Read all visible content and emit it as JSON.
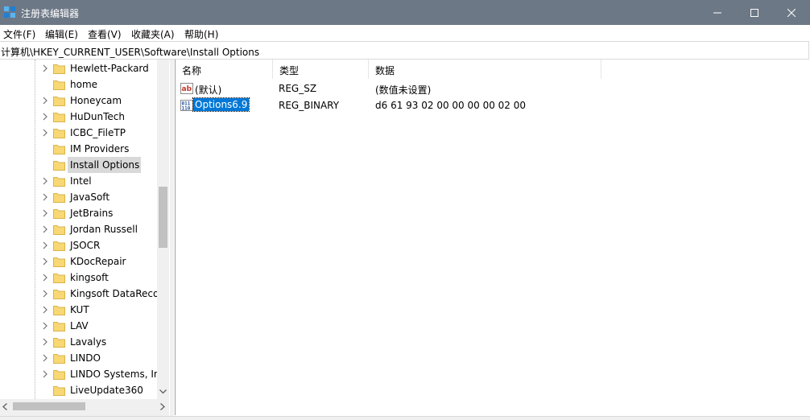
{
  "window": {
    "title": "注册表编辑器"
  },
  "menu": [
    "文件(F)",
    "编辑(E)",
    "查看(V)",
    "收藏夹(A)",
    "帮助(H)"
  ],
  "address": "计算机\\HKEY_CURRENT_USER\\Software\\Install Options",
  "tree": {
    "items": [
      {
        "label": "Hewlett-Packard",
        "expandable": true
      },
      {
        "label": "home",
        "expandable": false
      },
      {
        "label": "Honeycam",
        "expandable": true
      },
      {
        "label": "HuDunTech",
        "expandable": true
      },
      {
        "label": "ICBC_FileTP",
        "expandable": true
      },
      {
        "label": "IM Providers",
        "expandable": false
      },
      {
        "label": "Install Options",
        "expandable": false,
        "selected": true
      },
      {
        "label": "Intel",
        "expandable": true
      },
      {
        "label": "JavaSoft",
        "expandable": true
      },
      {
        "label": "JetBrains",
        "expandable": true
      },
      {
        "label": "Jordan Russell",
        "expandable": true
      },
      {
        "label": "JSOCR",
        "expandable": true
      },
      {
        "label": "KDocRepair",
        "expandable": true
      },
      {
        "label": "kingsoft",
        "expandable": true
      },
      {
        "label": "Kingsoft DataReco",
        "expandable": true
      },
      {
        "label": "KUT",
        "expandable": true
      },
      {
        "label": "LAV",
        "expandable": true
      },
      {
        "label": "Lavalys",
        "expandable": true
      },
      {
        "label": "LINDO",
        "expandable": true
      },
      {
        "label": "LINDO Systems, In",
        "expandable": true
      },
      {
        "label": "LiveUpdate360",
        "expandable": false
      }
    ]
  },
  "list": {
    "columns": [
      "名称",
      "类型",
      "数据"
    ],
    "rows": [
      {
        "icon": "string-value-icon",
        "name": "(默认)",
        "type": "REG_SZ",
        "data": "(数值未设置)",
        "selected": false
      },
      {
        "icon": "binary-value-icon",
        "name": "Options6.9",
        "type": "REG_BINARY",
        "data": "d6 61 93 02 00 00 00 00 02 00",
        "selected": true
      }
    ]
  },
  "colors": {
    "titlebar": "#6d7886",
    "selection": "#0078d7",
    "folder": "#f8d775"
  }
}
